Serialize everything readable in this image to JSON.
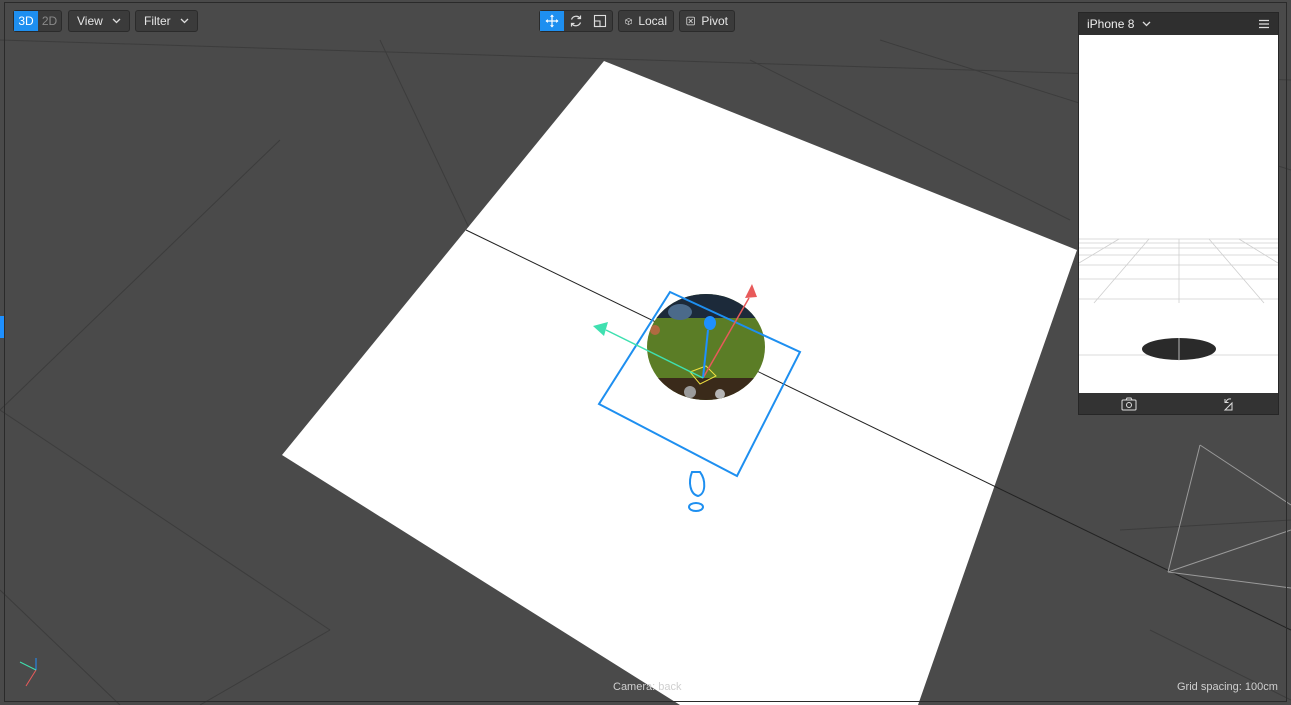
{
  "toolbar": {
    "mode_3d": "3D",
    "mode_2d": "2D",
    "view_label": "View",
    "filter_label": "Filter",
    "coord_label": "Local",
    "pivot_label": "Pivot"
  },
  "preview": {
    "device": "iPhone 8"
  },
  "status": {
    "camera": "Camera: back",
    "grid": "Grid spacing: 100cm"
  },
  "colors": {
    "accent": "#1e8ff0",
    "gizmo_x": "#e85a5a",
    "gizmo_y": "#1e90ff",
    "gizmo_z": "#3fe0b0",
    "selection": "#1e8ff0"
  },
  "icons": [
    "move-icon",
    "rotate-icon",
    "scale-icon",
    "cube-icon",
    "pivot-icon",
    "menu-icon",
    "screenshot-icon",
    "rotate-device-icon",
    "axis-indicator-icon"
  ]
}
